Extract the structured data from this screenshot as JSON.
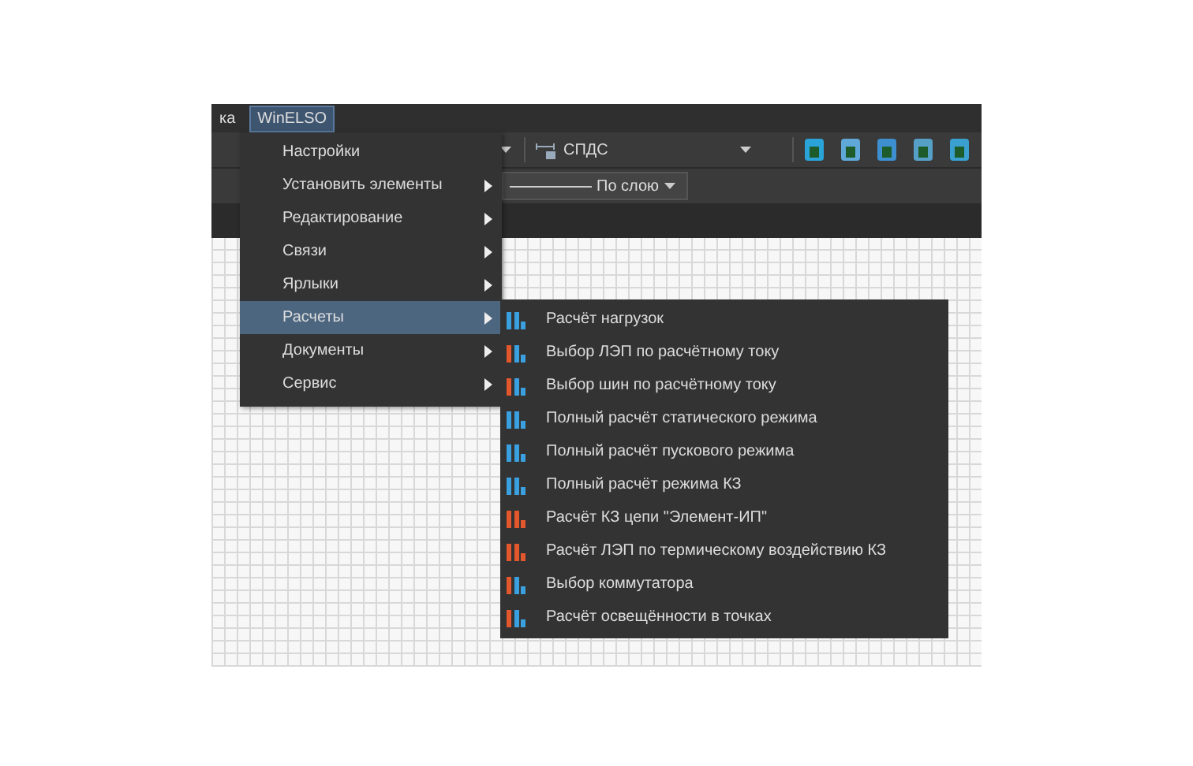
{
  "menu_bar": [
    {
      "label": "ка",
      "selected": false
    },
    {
      "label": "WinELSO",
      "selected": true
    }
  ],
  "toolbar": {
    "style_dropdown": {
      "value": "СПДС"
    },
    "linetype_dropdown": {
      "value": "По слою"
    }
  },
  "menu": [
    {
      "label": "Настройки",
      "submenu": false,
      "selected": false
    },
    {
      "label": "Установить элементы",
      "submenu": true,
      "selected": false
    },
    {
      "label": "Редактирование",
      "submenu": true,
      "selected": false
    },
    {
      "label": "Связи",
      "submenu": true,
      "selected": false
    },
    {
      "label": "Ярлыки",
      "submenu": true,
      "selected": false
    },
    {
      "label": "Расчеты",
      "submenu": true,
      "selected": true
    },
    {
      "label": "Документы",
      "submenu": true,
      "selected": false
    },
    {
      "label": "Сервис",
      "submenu": true,
      "selected": false
    }
  ],
  "submenu": [
    {
      "label": "Расчёт нагрузок"
    },
    {
      "label": "Выбор ЛЭП по расчётному току"
    },
    {
      "label": "Выбор шин по расчётному току"
    },
    {
      "label": "Полный расчёт статического режима"
    },
    {
      "label": "Полный расчёт пускового режима"
    },
    {
      "label": "Полный расчёт режима КЗ"
    },
    {
      "label": "Расчёт КЗ цепи \"Элемент-ИП\""
    },
    {
      "label": "Расчёт ЛЭП по термическому воздействию КЗ"
    },
    {
      "label": "Выбор коммутатора"
    },
    {
      "label": "Расчёт освещённости в точках"
    }
  ]
}
